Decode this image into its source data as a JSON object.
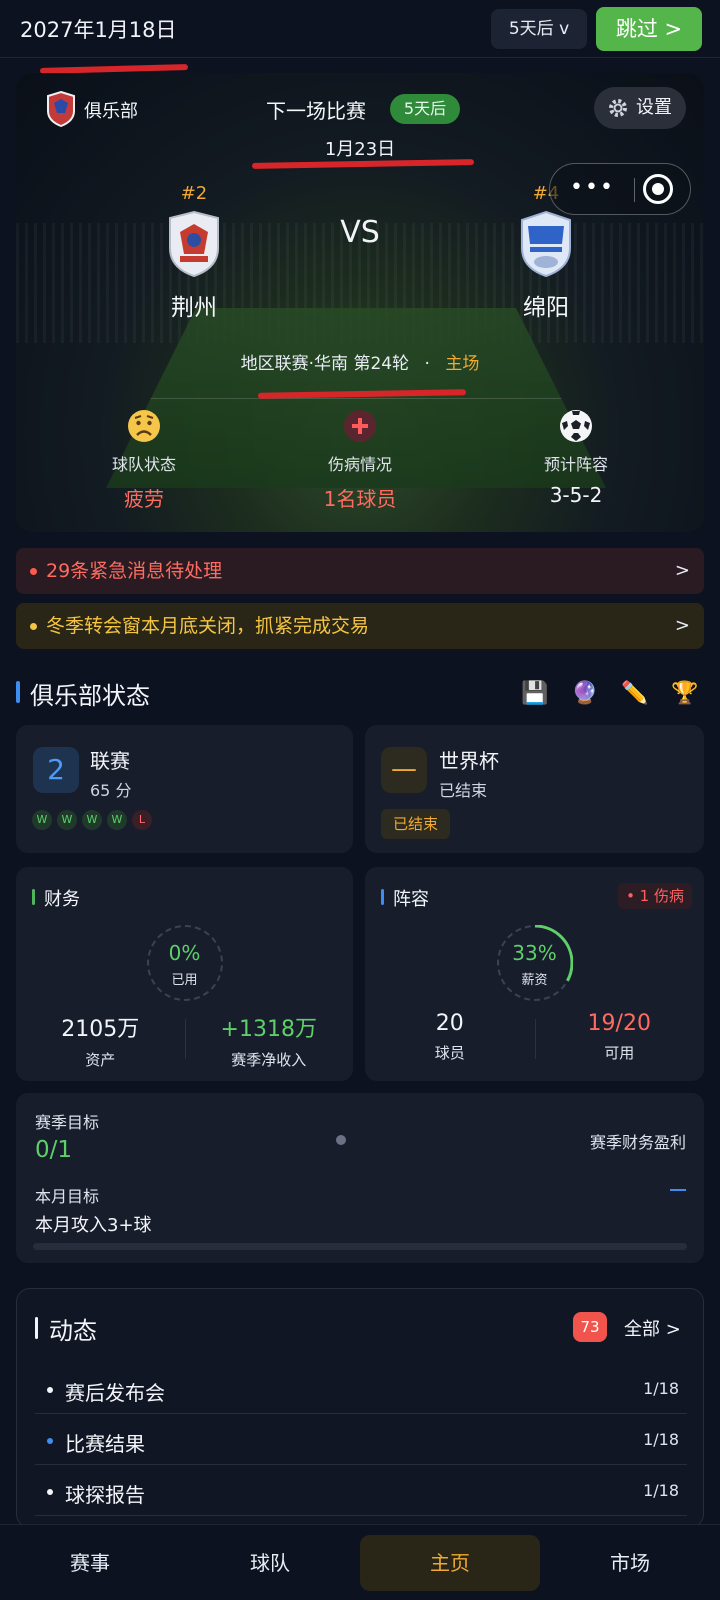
{
  "topbar": {
    "date": "2027年1月18日",
    "advance_label": "5天后 v",
    "skip_label": "跳过 >"
  },
  "next_match": {
    "club_label": "俱乐部",
    "title": "下一场比赛",
    "days_badge": "5天后",
    "date": "1月23日",
    "settings_label": "设置",
    "capsule_dots": "•••",
    "home": {
      "rank": "#2",
      "name": "荆州"
    },
    "vs": "VS",
    "away": {
      "rank": "#4",
      "name": "绵阳"
    },
    "league": "地区联赛·华南  第24轮",
    "sep": "·",
    "venue": "主场"
  },
  "stats": [
    {
      "label": "球队状态",
      "value": "疲劳",
      "icon": "worried-face-icon",
      "color": "#ff6b5f"
    },
    {
      "label": "伤病情况",
      "value": "1名球员",
      "icon": "medical-cross-icon",
      "color": "#ff6b5f"
    },
    {
      "label": "预计阵容",
      "value": "3-5-2",
      "icon": "soccer-ball-icon",
      "color": "#f3f5fa"
    }
  ],
  "alerts": {
    "urgent": {
      "text": "29条紧急消息待处理",
      "arrow": ">"
    },
    "transfer": {
      "text": "冬季转会窗本月底关闭，抓紧完成交易",
      "arrow": ">"
    }
  },
  "club_status": {
    "title": "俱乐部状态",
    "icons": [
      "save-icon",
      "crystal-ball-icon",
      "pencil-icon",
      "trophy-icon"
    ],
    "icon_glyphs": [
      "💾",
      "🔮",
      "✏️",
      "🏆"
    ],
    "league": {
      "rank": "2",
      "title": "联赛",
      "points": "65 分",
      "form": [
        "W",
        "W",
        "W",
        "W",
        "L"
      ]
    },
    "cup": {
      "mark": "—",
      "title": "世界杯",
      "status": "已结束",
      "tag": "已结束"
    },
    "finance": {
      "title": "财务",
      "ring_value": "0%",
      "ring_label": "已用",
      "used_fraction": 0,
      "assets": "2105万",
      "assets_label": "资产",
      "net": "+1318万",
      "net_label": "赛季净收入"
    },
    "squad": {
      "title": "阵容",
      "injury_tag": "• 1 伤病",
      "ring_value": "33%",
      "ring_label": "薪资",
      "salary_fraction": 0.33,
      "players": "20",
      "players_label": "球员",
      "available": "19/20",
      "available_label": "可用"
    }
  },
  "goals": {
    "season_label": "赛季目标",
    "season_value": "0/1",
    "season_goal": "赛季财务盈利",
    "month_label": "本月目标",
    "month_goal": "本月攻入3+球",
    "month_progress": 0
  },
  "feed": {
    "title": "动态",
    "count": "73",
    "all_label": "全部 >",
    "items": [
      {
        "title": "赛后发布会",
        "date": "1/18",
        "bullet": "#f3f5fa"
      },
      {
        "title": "比赛结果",
        "date": "1/18",
        "bullet": "#3e8df0"
      },
      {
        "title": "球探报告",
        "date": "1/18",
        "bullet": "#f3f5fa"
      }
    ]
  },
  "tabs": [
    {
      "label": "赛事"
    },
    {
      "label": "球队"
    },
    {
      "label": "主页",
      "active": true
    },
    {
      "label": "市场"
    }
  ],
  "colors": {
    "accent_green": "#54b54a",
    "accent_gold": "#f0a932",
    "accent_blue": "#3e8df0",
    "alert_red": "#ff6b5f",
    "alert_yellow": "#f4c542"
  }
}
